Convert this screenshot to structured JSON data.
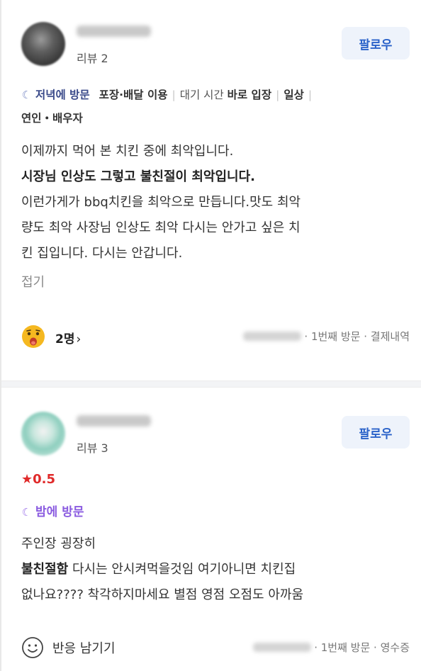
{
  "review1": {
    "follow_label": "팔로우",
    "review_count": "리뷰 2",
    "tags": {
      "visit_time": "저녁에 방문",
      "service": "포장·배달 이용",
      "wait_label": "대기 시간",
      "wait_value": "바로 입장",
      "purpose": "일상",
      "companion": "연인・배우자"
    },
    "lines": [
      "이제까지 먹어 본 치킨 중에 최악입니다.",
      "시장님 인상도 그렇고 불친절이 최악입니다.",
      "이런가게가 bbq치킨을 최악으로 만듭니다.맛도 최악",
      "량도 최악 사장님 인상도 최악 다시는 안가고 싶은 치",
      "킨 집입니다. 다시는 안갑니다."
    ],
    "fold_label": "접기",
    "reaction_count": "2명",
    "visit_order": "1번째 방문",
    "verification": "결제내역"
  },
  "review2": {
    "follow_label": "팔로우",
    "review_count": "리뷰 3",
    "rating": "0.5",
    "visit_time": "밤에 방문",
    "line1": "주인장 굉장히",
    "line2_bold": "불친절함",
    "line2_rest": " 다시는 안시켜먹을것임 여기아니면 치킨집",
    "line3": "없나요???? 착각하지마세요 별점 영점 오점도 아까움",
    "react_label": "반응 남기기",
    "visit_order": "1번째 방문",
    "verification": "영수증"
  },
  "colors": {
    "follow_text": "#2a62c9",
    "follow_bg": "#eef3fb",
    "rating_red": "#e02a2a",
    "visit_purple": "#8a5be0"
  },
  "icons": {
    "moon": "moon-icon",
    "star": "star-icon",
    "emoji": "worried-emoji-icon",
    "smile": "smile-icon",
    "chevron": "chevron-right-icon"
  }
}
